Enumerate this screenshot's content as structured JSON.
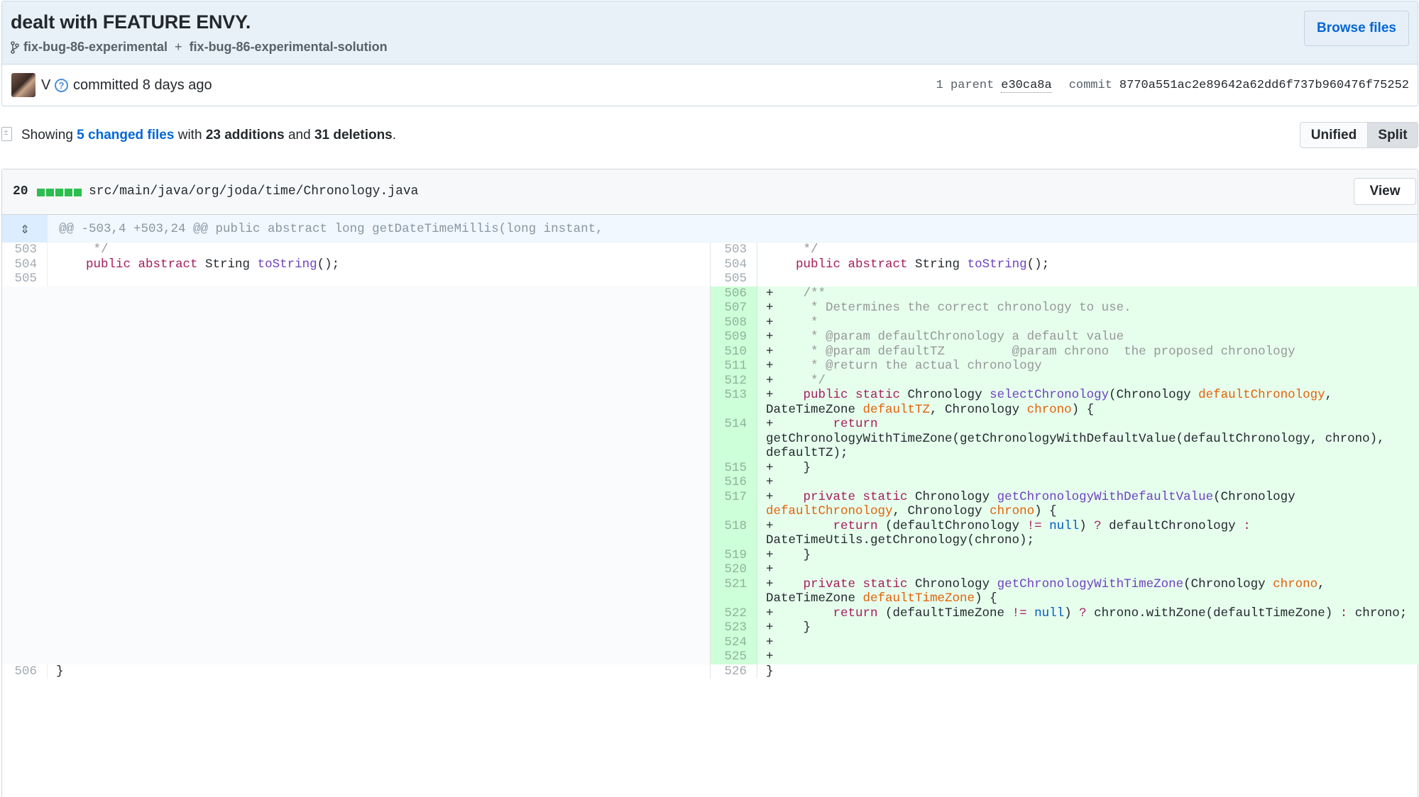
{
  "commit": {
    "title": "dealt with FEATURE ENVY.",
    "branch_from": "fix-bug-86-experimental",
    "branch_sep": "+",
    "branch_to": "fix-bug-86-experimental-solution",
    "browse_label": "Browse files",
    "author": "V",
    "committed_text": "committed 8 days ago",
    "parent_label": "1 parent",
    "parent_sha": "e30ca8a",
    "commit_label": "commit",
    "commit_sha": "8770a551ac2e89642a62dd6f737b960476f75252"
  },
  "toc": {
    "showing": "Showing",
    "changed_files": "5 changed files",
    "with": "with",
    "additions": "23 additions",
    "and": "and",
    "deletions": "31 deletions",
    "period": ".",
    "unified_label": "Unified",
    "split_label": "Split"
  },
  "file": {
    "changes": "20",
    "diffstat_blocks": 5,
    "path": "src/main/java/org/joda/time/Chronology.java",
    "view_label": "View",
    "hunk_header": "@@ -503,4 +503,24 @@ public abstract long getDateTimeMillis(long instant,"
  },
  "colors": {
    "addition_bg": "#e6ffed",
    "addition_num_bg": "#cdffd8",
    "hunk_bg": "#f1f8ff",
    "link": "#0366d6",
    "header_bg": "#e8f1f8"
  },
  "rows": [
    {
      "type": "ctx",
      "left_num": "503",
      "right_num": "503",
      "left_lines": 1,
      "right_lines": 1,
      "left": [
        [
          "cm",
          "     */"
        ]
      ],
      "right": [
        [
          "cm",
          "     */"
        ]
      ]
    },
    {
      "type": "ctx",
      "left_num": "504",
      "right_num": "504",
      "left_lines": 1,
      "right_lines": 1,
      "left": [
        [
          "",
          "    "
        ],
        [
          "kw",
          "public abstract"
        ],
        [
          "",
          " String "
        ],
        [
          "fn",
          "toString"
        ],
        [
          "",
          "();"
        ]
      ],
      "right": [
        [
          "",
          "    "
        ],
        [
          "kw",
          "public abstract"
        ],
        [
          "",
          " String "
        ],
        [
          "fn",
          "toString"
        ],
        [
          "",
          "();"
        ]
      ]
    },
    {
      "type": "ctx",
      "left_num": "505",
      "right_num": "505",
      "left_lines": 1,
      "right_lines": 1,
      "left": [
        [
          "",
          ""
        ]
      ],
      "right": [
        [
          "",
          ""
        ]
      ]
    },
    {
      "type": "add",
      "right_num": "506",
      "right_lines": 1,
      "right": [
        [
          "",
          "+    "
        ],
        [
          "cm",
          "/**"
        ]
      ]
    },
    {
      "type": "add",
      "right_num": "507",
      "right_lines": 1,
      "right": [
        [
          "",
          "+     "
        ],
        [
          "cm",
          "* Determines the correct chronology to use."
        ]
      ]
    },
    {
      "type": "add",
      "right_num": "508",
      "right_lines": 1,
      "right": [
        [
          "",
          "+     "
        ],
        [
          "cm",
          "*"
        ]
      ]
    },
    {
      "type": "add",
      "right_num": "509",
      "right_lines": 1,
      "right": [
        [
          "",
          "+     "
        ],
        [
          "cm",
          "* @param defaultChronology a default value"
        ]
      ]
    },
    {
      "type": "add",
      "right_num": "510",
      "right_lines": 1,
      "right": [
        [
          "",
          "+     "
        ],
        [
          "cm",
          "* @param defaultTZ         @param chrono  the proposed chronology"
        ]
      ]
    },
    {
      "type": "add",
      "right_num": "511",
      "right_lines": 1,
      "right": [
        [
          "",
          "+     "
        ],
        [
          "cm",
          "* @return the actual chronology"
        ]
      ]
    },
    {
      "type": "add",
      "right_num": "512",
      "right_lines": 1,
      "right": [
        [
          "",
          "+     "
        ],
        [
          "cm",
          "*/"
        ]
      ]
    },
    {
      "type": "add",
      "right_num": "513",
      "right_lines": 2,
      "right": [
        [
          "",
          "+    "
        ],
        [
          "kw",
          "public static"
        ],
        [
          "",
          " Chronology "
        ],
        [
          "fn",
          "selectChronology"
        ],
        [
          "",
          "(Chronology "
        ],
        [
          "par",
          "defaultChronology"
        ],
        [
          "",
          ",\nDateTimeZone "
        ],
        [
          "par",
          "defaultTZ"
        ],
        [
          "",
          ", Chronology "
        ],
        [
          "par",
          "chrono"
        ],
        [
          "",
          ") {"
        ]
      ]
    },
    {
      "type": "add",
      "right_num": "514",
      "right_lines": 3,
      "right": [
        [
          "",
          "+        "
        ],
        [
          "kw",
          "return"
        ],
        [
          "",
          "\ngetChronologyWithTimeZone(getChronologyWithDefaultValue(defaultChronology, chrono),\ndefaultTZ);"
        ]
      ]
    },
    {
      "type": "add",
      "right_num": "515",
      "right_lines": 1,
      "right": [
        [
          "",
          "+    }"
        ]
      ]
    },
    {
      "type": "add",
      "right_num": "516",
      "right_lines": 1,
      "right": [
        [
          "",
          "+"
        ]
      ]
    },
    {
      "type": "add",
      "right_num": "517",
      "right_lines": 2,
      "right": [
        [
          "",
          "+    "
        ],
        [
          "kw",
          "private static"
        ],
        [
          "",
          " Chronology "
        ],
        [
          "fn",
          "getChronologyWithDefaultValue"
        ],
        [
          "",
          "(Chronology\n"
        ],
        [
          "par",
          "defaultChronology"
        ],
        [
          "",
          ", Chronology "
        ],
        [
          "par",
          "chrono"
        ],
        [
          "",
          ") {"
        ]
      ]
    },
    {
      "type": "add",
      "right_num": "518",
      "right_lines": 2,
      "right": [
        [
          "",
          "+        "
        ],
        [
          "kw",
          "return"
        ],
        [
          "",
          " (defaultChronology "
        ],
        [
          "kw",
          "!="
        ],
        [
          "",
          " "
        ],
        [
          "cst",
          "null"
        ],
        [
          "",
          ") "
        ],
        [
          "kw",
          "?"
        ],
        [
          "",
          " defaultChronology "
        ],
        [
          "kw",
          ":"
        ],
        [
          "",
          "\nDateTimeUtils.getChronology(chrono);"
        ]
      ]
    },
    {
      "type": "add",
      "right_num": "519",
      "right_lines": 1,
      "right": [
        [
          "",
          "+    }"
        ]
      ]
    },
    {
      "type": "add",
      "right_num": "520",
      "right_lines": 1,
      "right": [
        [
          "",
          "+"
        ]
      ]
    },
    {
      "type": "add",
      "right_num": "521",
      "right_lines": 2,
      "right": [
        [
          "",
          "+    "
        ],
        [
          "kw",
          "private static"
        ],
        [
          "",
          " Chronology "
        ],
        [
          "fn",
          "getChronologyWithTimeZone"
        ],
        [
          "",
          "(Chronology "
        ],
        [
          "par",
          "chrono"
        ],
        [
          "",
          ",\nDateTimeZone "
        ],
        [
          "par",
          "defaultTimeZone"
        ],
        [
          "",
          ") {"
        ]
      ]
    },
    {
      "type": "add",
      "right_num": "522",
      "right_lines": 1,
      "right": [
        [
          "",
          "+        "
        ],
        [
          "kw",
          "return"
        ],
        [
          "",
          " (defaultTimeZone "
        ],
        [
          "kw",
          "!="
        ],
        [
          "",
          " "
        ],
        [
          "cst",
          "null"
        ],
        [
          "",
          ") "
        ],
        [
          "kw",
          "?"
        ],
        [
          "",
          " chrono.withZone(defaultTimeZone) "
        ],
        [
          "kw",
          ":"
        ],
        [
          "",
          " chrono;"
        ]
      ]
    },
    {
      "type": "add",
      "right_num": "523",
      "right_lines": 1,
      "right": [
        [
          "",
          "+    }"
        ]
      ]
    },
    {
      "type": "add",
      "right_num": "524",
      "right_lines": 1,
      "right": [
        [
          "",
          "+"
        ]
      ]
    },
    {
      "type": "add",
      "right_num": "525",
      "right_lines": 1,
      "right": [
        [
          "",
          "+"
        ]
      ]
    },
    {
      "type": "ctx",
      "left_num": "506",
      "right_num": "526",
      "left_lines": 1,
      "right_lines": 1,
      "left": [
        [
          "",
          "}"
        ]
      ],
      "right": [
        [
          "",
          "}"
        ]
      ]
    }
  ]
}
